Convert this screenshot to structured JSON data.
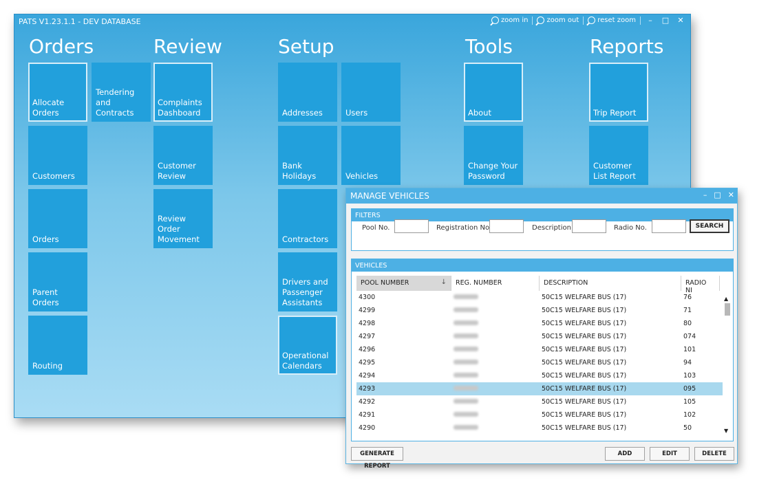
{
  "app": {
    "title": "PATS V1.23.1.1  -  DEV DATABASE",
    "zoom_in": "zoom in",
    "zoom_out": "zoom out",
    "reset_zoom": "reset zoom",
    "minimize": "–",
    "maximize": "□",
    "close": "✕"
  },
  "sections": {
    "orders": "Orders",
    "review": "Review",
    "setup": "Setup",
    "tools": "Tools",
    "reports": "Reports"
  },
  "tiles": {
    "allocate_orders": "Allocate Orders",
    "tendering": "Tendering and Contracts",
    "complaints": "Complaints Dashboard",
    "customers": "Customers",
    "orders": "Orders",
    "parent_orders": "Parent Orders",
    "routing": "Routing",
    "customer_review": "Customer Review",
    "review_order_movement": "Review Order Movement",
    "addresses": "Addresses",
    "users": "Users",
    "bank_holidays": "Bank Holidays",
    "vehicles": "Vehicles",
    "contractors": "Contractors",
    "drivers": "Drivers and Passenger Assistants",
    "operational_calendars": "Operational Calendars",
    "about": "About",
    "change_password": "Change Your Password",
    "trip_report": "Trip Report",
    "customer_list_report": "Customer List Report"
  },
  "manage_vehicles": {
    "title": "MANAGE VEHICLES",
    "minimize": "–",
    "maximize": "□",
    "close": "✕",
    "filters_title": "FILTERS",
    "pool_no_label": "Pool No.",
    "registration_label": "Registration No.",
    "description_label": "Description",
    "radio_label": "Radio No.",
    "pool_no_value": "",
    "registration_value": "",
    "description_value": "",
    "radio_value": "",
    "search_label": "SEARCH",
    "vehicles_title": "VEHICLES",
    "columns": [
      "POOL NUMBER",
      "REG. NUMBER",
      "DESCRIPTION",
      "RADIO NI"
    ],
    "rows": [
      {
        "pool": "4300",
        "desc": "50C15 WELFARE BUS (17)",
        "radio": "76"
      },
      {
        "pool": "4299",
        "desc": "50C15 WELFARE BUS (17)",
        "radio": "71"
      },
      {
        "pool": "4298",
        "desc": "50C15 WELFARE BUS (17)",
        "radio": "80"
      },
      {
        "pool": "4297",
        "desc": "50C15 WELFARE BUS (17)",
        "radio": "074"
      },
      {
        "pool": "4296",
        "desc": "50C15 WELFARE BUS (17)",
        "radio": "101"
      },
      {
        "pool": "4295",
        "desc": "50C15 WELFARE BUS (17)",
        "radio": "94"
      },
      {
        "pool": "4294",
        "desc": "50C15 WELFARE BUS (17)",
        "radio": "103"
      },
      {
        "pool": "4293",
        "desc": "50C15 WELFARE BUS (17)",
        "radio": "095"
      },
      {
        "pool": "4292",
        "desc": "50C15 WELFARE BUS (17)",
        "radio": "105"
      },
      {
        "pool": "4291",
        "desc": "50C15 WELFARE BUS (17)",
        "radio": "102"
      },
      {
        "pool": "4290",
        "desc": "50C15 WELFARE BUS (17)",
        "radio": "50"
      }
    ],
    "selected_row": 7,
    "generate_report": "GENERATE REPORT",
    "add": "ADD",
    "edit": "EDIT",
    "delete": "DELETE"
  },
  "colors": {
    "tile": "#22a0dc",
    "accent": "#4db0e4",
    "selected_row": "#a8d8ee"
  }
}
